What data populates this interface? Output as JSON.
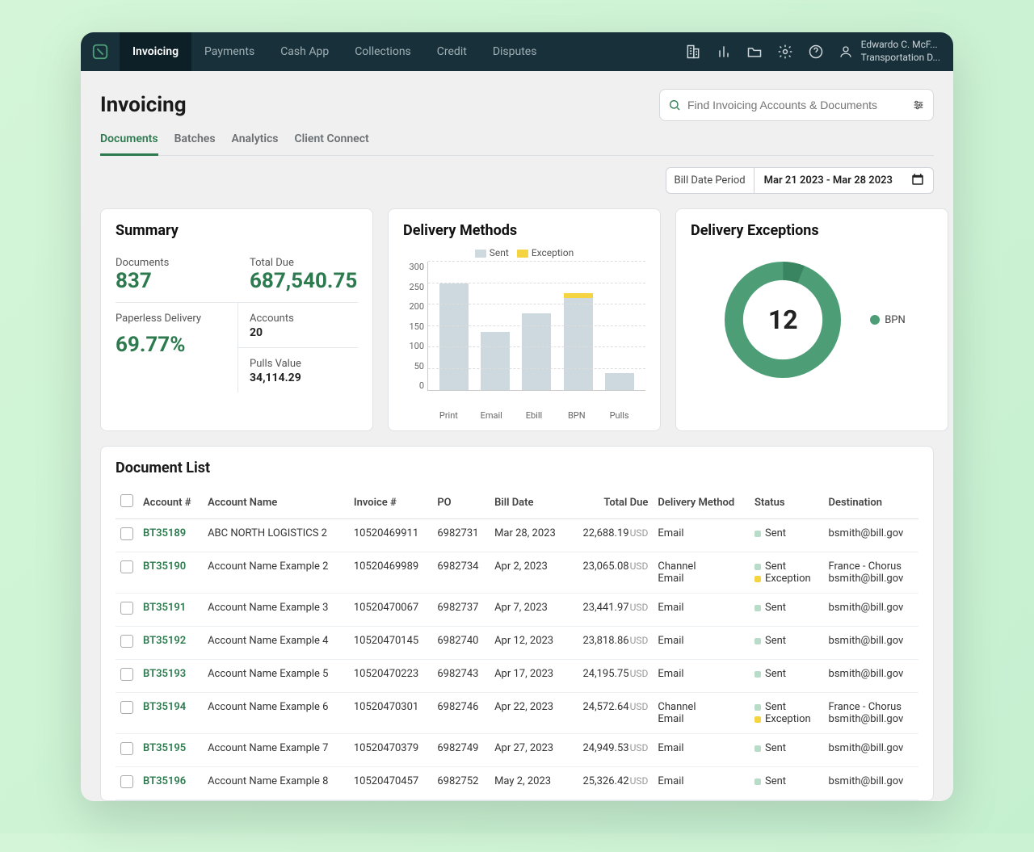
{
  "header": {
    "nav": [
      "Invoicing",
      "Payments",
      "Cash App",
      "Collections",
      "Credit",
      "Disputes"
    ],
    "active_nav": 0,
    "user_name": "Edwardo C. McF...",
    "user_sub": "Transportation D..."
  },
  "page": {
    "title": "Invoicing",
    "tabs": [
      "Documents",
      "Batches",
      "Analytics",
      "Client Connect"
    ],
    "active_tab": 0,
    "search_placeholder": "Find Invoicing Accounts & Documents",
    "bill_period_label": "Bill Date Period",
    "bill_period_value": "Mar 21 2023 - Mar 28 2023"
  },
  "summary": {
    "title": "Summary",
    "documents_label": "Documents",
    "documents": "837",
    "total_due_label": "Total Due",
    "total_due": "687,540.75",
    "paperless_label": "Paperless Delivery",
    "paperless": "69.77%",
    "accounts_label": "Accounts",
    "accounts": "20",
    "pulls_label": "Pulls Value",
    "pulls": "34,114.29"
  },
  "delivery_methods": {
    "title": "Delivery Methods",
    "legend_sent": "Sent",
    "legend_exception": "Exception"
  },
  "delivery_exceptions": {
    "title": "Delivery Exceptions",
    "value": "12",
    "legend": "BPN"
  },
  "chart_data": {
    "type": "bar",
    "title": "Delivery Methods",
    "categories": [
      "Print",
      "Email",
      "Ebill",
      "BPN",
      "Pulls"
    ],
    "series": [
      {
        "name": "Sent",
        "values": [
          250,
          135,
          180,
          215,
          40
        ],
        "color": "#cdd9de"
      },
      {
        "name": "Exception",
        "values": [
          0,
          0,
          0,
          12,
          0
        ],
        "color": "#f5d442"
      }
    ],
    "ylim": [
      0,
      300
    ],
    "yticks": [
      0,
      50,
      100,
      150,
      200,
      250,
      300
    ],
    "stacked": true
  },
  "doclist": {
    "title": "Document List",
    "columns": [
      "Account #",
      "Account Name",
      "Invoice #",
      "PO",
      "Bill Date",
      "Total Due",
      "Delivery Method",
      "Status",
      "Destination"
    ],
    "currency": "USD",
    "rows": [
      {
        "account": "BT35189",
        "name": "ABC NORTH LOGISTICS 2",
        "invoice": "10520469911",
        "po": "6982731",
        "date": "Mar 28, 2023",
        "due": "22,688.19",
        "delivery": [
          "Email"
        ],
        "status": [
          "Sent"
        ],
        "dest": [
          "bsmith@bill.gov"
        ]
      },
      {
        "account": "BT35190",
        "name": "Account Name Example 2",
        "invoice": "10520469989",
        "po": "6982734",
        "date": "Apr 2, 2023",
        "due": "23,065.08",
        "delivery": [
          "Channel",
          "Email"
        ],
        "status": [
          "Sent",
          "Exception"
        ],
        "dest": [
          "France - Chorus",
          "bsmith@bill.gov"
        ]
      },
      {
        "account": "BT35191",
        "name": "Account Name Example 3",
        "invoice": "10520470067",
        "po": "6982737",
        "date": "Apr 7, 2023",
        "due": "23,441.97",
        "delivery": [
          "Email"
        ],
        "status": [
          "Sent"
        ],
        "dest": [
          "bsmith@bill.gov"
        ]
      },
      {
        "account": "BT35192",
        "name": "Account Name Example 4",
        "invoice": "10520470145",
        "po": "6982740",
        "date": "Apr 12, 2023",
        "due": "23,818.86",
        "delivery": [
          "Email"
        ],
        "status": [
          "Sent"
        ],
        "dest": [
          "bsmith@bill.gov"
        ]
      },
      {
        "account": "BT35193",
        "name": "Account Name Example 5",
        "invoice": "10520470223",
        "po": "6982743",
        "date": "Apr 17, 2023",
        "due": "24,195.75",
        "delivery": [
          "Email"
        ],
        "status": [
          "Sent"
        ],
        "dest": [
          "bsmith@bill.gov"
        ]
      },
      {
        "account": "BT35194",
        "name": "Account Name Example 6",
        "invoice": "10520470301",
        "po": "6982746",
        "date": "Apr 22, 2023",
        "due": "24,572.64",
        "delivery": [
          "Channel",
          "Email"
        ],
        "status": [
          "Sent",
          "Exception"
        ],
        "dest": [
          "France - Chorus",
          "bsmith@bill.gov"
        ]
      },
      {
        "account": "BT35195",
        "name": "Account Name Example 7",
        "invoice": "10520470379",
        "po": "6982749",
        "date": "Apr 27, 2023",
        "due": "24,949.53",
        "delivery": [
          "Email"
        ],
        "status": [
          "Sent"
        ],
        "dest": [
          "bsmith@bill.gov"
        ]
      },
      {
        "account": "BT35196",
        "name": "Account Name Example 8",
        "invoice": "10520470457",
        "po": "6982752",
        "date": "May 2, 2023",
        "due": "25,326.42",
        "delivery": [
          "Email"
        ],
        "status": [
          "Sent"
        ],
        "dest": [
          "bsmith@bill.gov"
        ]
      }
    ]
  }
}
